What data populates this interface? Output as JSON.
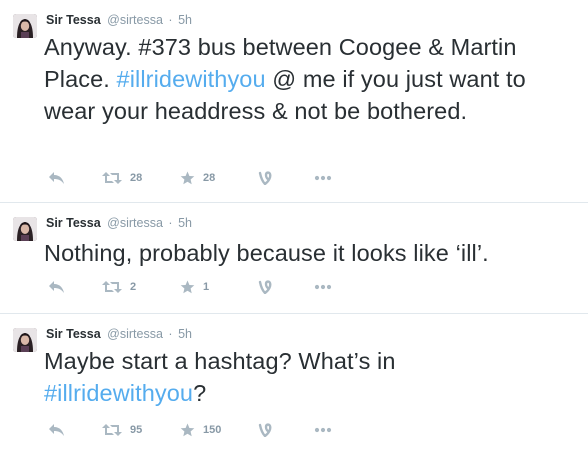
{
  "colors": {
    "hashtag": "#55acee",
    "meta": "#8899a6",
    "icon": "#aab8c2",
    "text": "#292f33",
    "divider": "#e1e8ed"
  },
  "tweets": [
    {
      "fullname": "Sir Tessa",
      "username": "@sirtessa",
      "separator": "·",
      "time": "5h",
      "text_before": "Anyway. #373 bus between Coogee & Martin Place. ",
      "hashtag": "#illridewithyou",
      "text_after": " @ me if you just want to wear your headdress & not be bothered.",
      "retweets": "28",
      "favorites": "28",
      "icons": [
        "reply-icon",
        "retweet-icon",
        "star-icon",
        "vine-icon",
        "more-icon"
      ]
    },
    {
      "fullname": "Sir Tessa",
      "username": "@sirtessa",
      "separator": "·",
      "time": "5h",
      "text_before": "Nothing, probably because it looks like ‘ill’.",
      "hashtag": "",
      "text_after": "",
      "retweets": "2",
      "favorites": "1",
      "icons": [
        "reply-icon",
        "retweet-icon",
        "star-icon",
        "vine-icon",
        "more-icon"
      ]
    },
    {
      "fullname": "Sir Tessa",
      "username": "@sirtessa",
      "separator": "·",
      "time": "5h",
      "text_before": "Maybe start a hashtag? What’s in ",
      "hashtag": "#illridewithyou",
      "text_after": "?",
      "retweets": "95",
      "favorites": "150",
      "icons": [
        "reply-icon",
        "retweet-icon",
        "star-icon",
        "vine-icon",
        "more-icon"
      ]
    }
  ]
}
